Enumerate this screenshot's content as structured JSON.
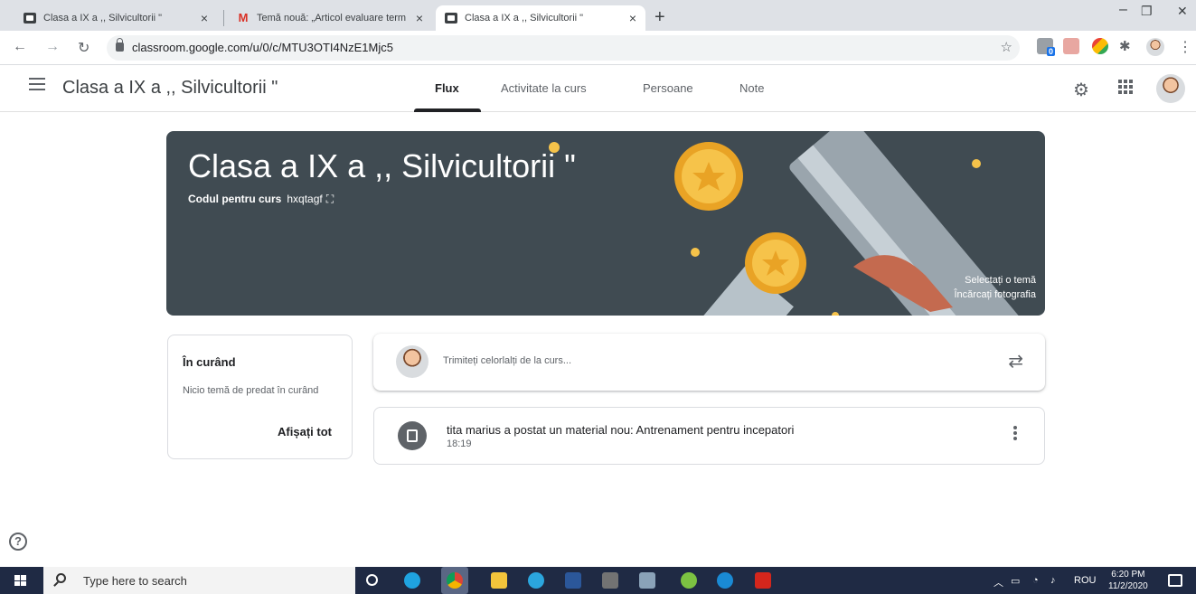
{
  "browser": {
    "tabs": [
      {
        "title": "Clasa a IX a ,, Silvicultorii \"",
        "close": "×"
      },
      {
        "title": "Temă nouă: „Articol evaluare term",
        "close": "×"
      },
      {
        "title": "Clasa a IX a ,, Silvicultorii \"",
        "close": "×"
      }
    ],
    "new_tab": "+",
    "url": "classroom.google.com/u/0/c/MTU3OTI4NzE1Mjc5",
    "ext_badge": "0"
  },
  "classroom": {
    "title": "Clasa a IX a ,, Silvicultorii \"",
    "tabs": [
      "Flux",
      "Activitate la curs",
      "Persoane",
      "Note"
    ],
    "active_tab": "Flux"
  },
  "banner": {
    "title": "Clasa a IX a ,, Silvicultorii \"",
    "code_label": "Codul pentru curs",
    "code": "hxqtagf",
    "select_theme": "Selectați o temă",
    "upload_photo": "Încărcați fotografia",
    "colors": {
      "bg": "#404b52",
      "accent": "#f6c34a"
    }
  },
  "upcoming": {
    "title": "În curând",
    "text": "Nicio temă de predat în curând",
    "link": "Afișați tot"
  },
  "share": {
    "placeholder": "Trimiteți celorlalți de la curs..."
  },
  "post": {
    "text": "tita marius a postat un material nou: Antrenament pentru incepatori",
    "time": "18:19"
  },
  "taskbar": {
    "search_placeholder": "Type here to search",
    "lang": "ROU",
    "time": "6:20 PM",
    "date": "11/2/2020"
  },
  "icons": [
    "hamburger-icon",
    "gear-icon",
    "apps-grid-icon",
    "repost-icon",
    "more-vert-icon",
    "help-icon",
    "lock-icon",
    "star-icon"
  ]
}
